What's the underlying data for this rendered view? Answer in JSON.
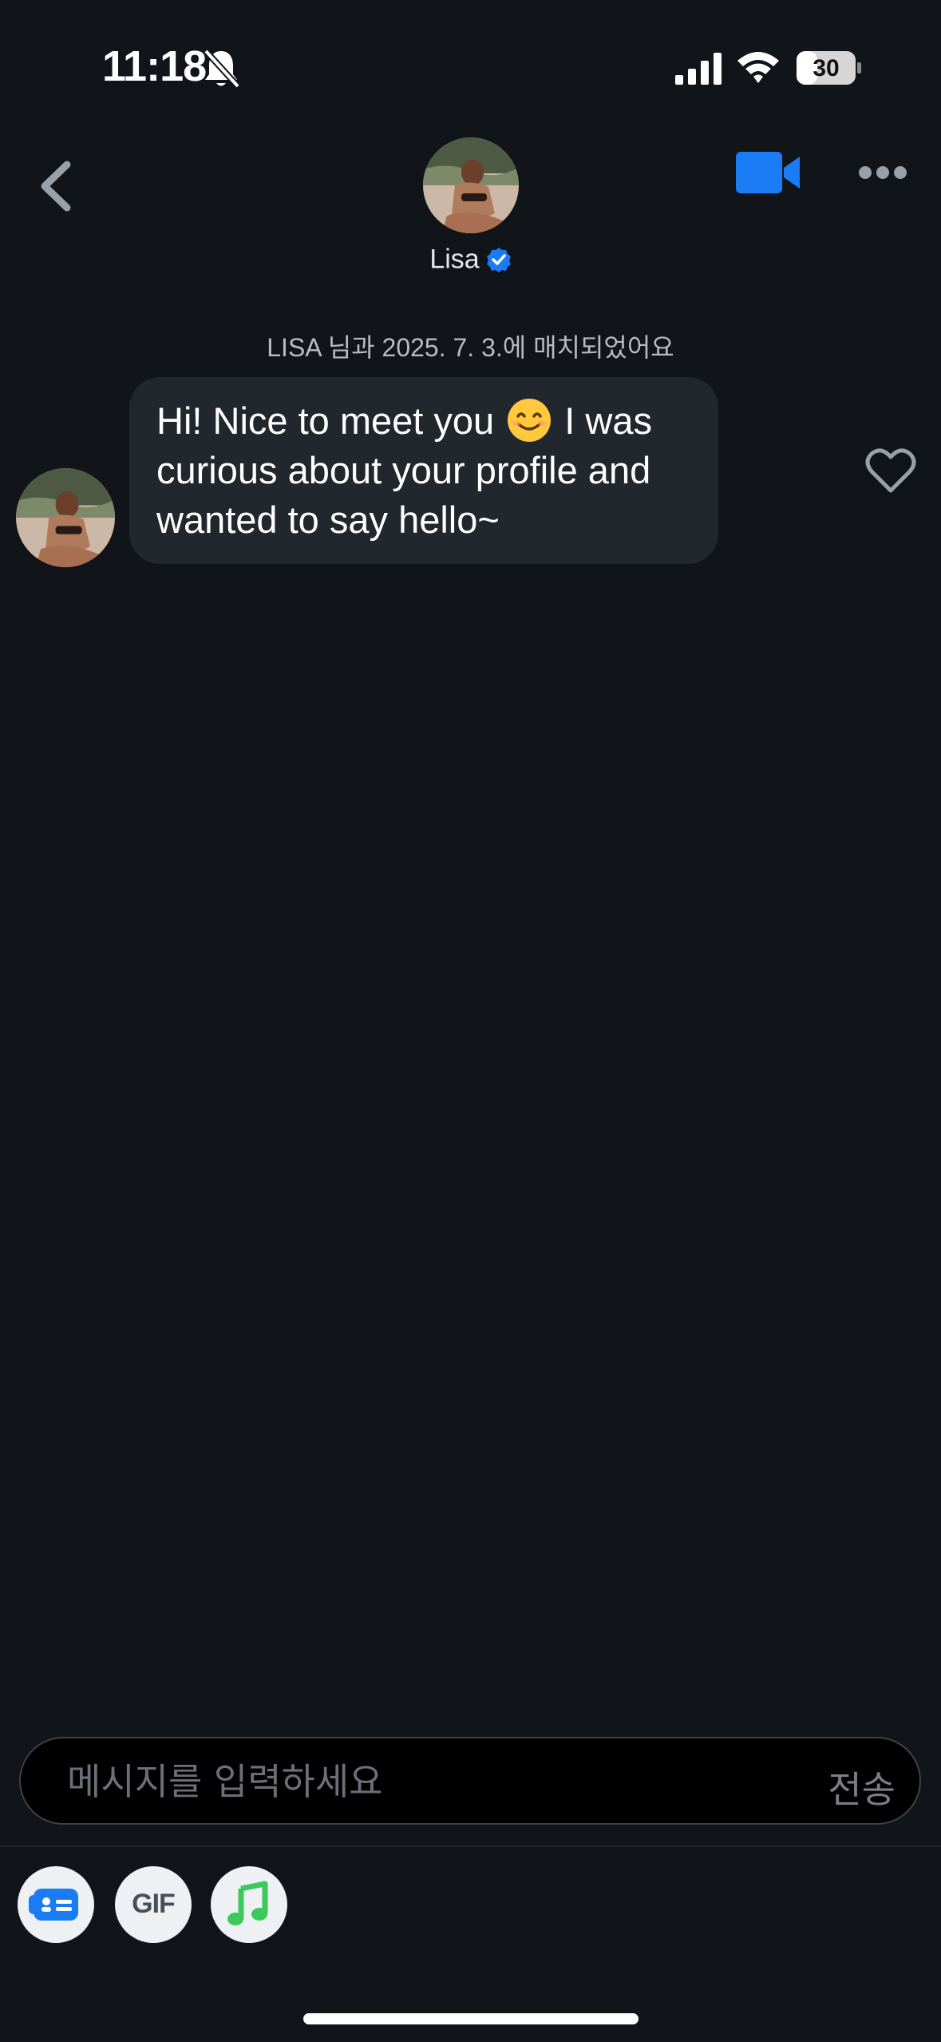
{
  "status_bar": {
    "time": "11:18",
    "battery": "30"
  },
  "header": {
    "contact_name": "Lisa",
    "verified": true
  },
  "chat": {
    "match_note": "LISA 님과 2025. 7. 3.에 매치되었어요",
    "messages": [
      {
        "line_a": "Hi! Nice to meet you",
        "line_b": " I was",
        "line_c": "curious about your profile and",
        "line_d": "wanted to say hello~"
      }
    ]
  },
  "composer": {
    "placeholder": "메시지를 입력하세요",
    "send_label": "전송"
  },
  "toolbar": {
    "gif_label": "GIF"
  },
  "colors": {
    "accent": "#1a7cf5",
    "background": "#111418",
    "bubble": "#22262d",
    "music": "#3cc85a"
  },
  "icons": [
    "bell-slash-icon",
    "signal-icon",
    "wifi-icon",
    "battery-icon",
    "back-chevron-icon",
    "verified-badge-icon",
    "video-camera-icon",
    "more-dots-icon",
    "smile-emoji-icon",
    "heart-icon",
    "card-icon",
    "music-note-icon"
  ]
}
